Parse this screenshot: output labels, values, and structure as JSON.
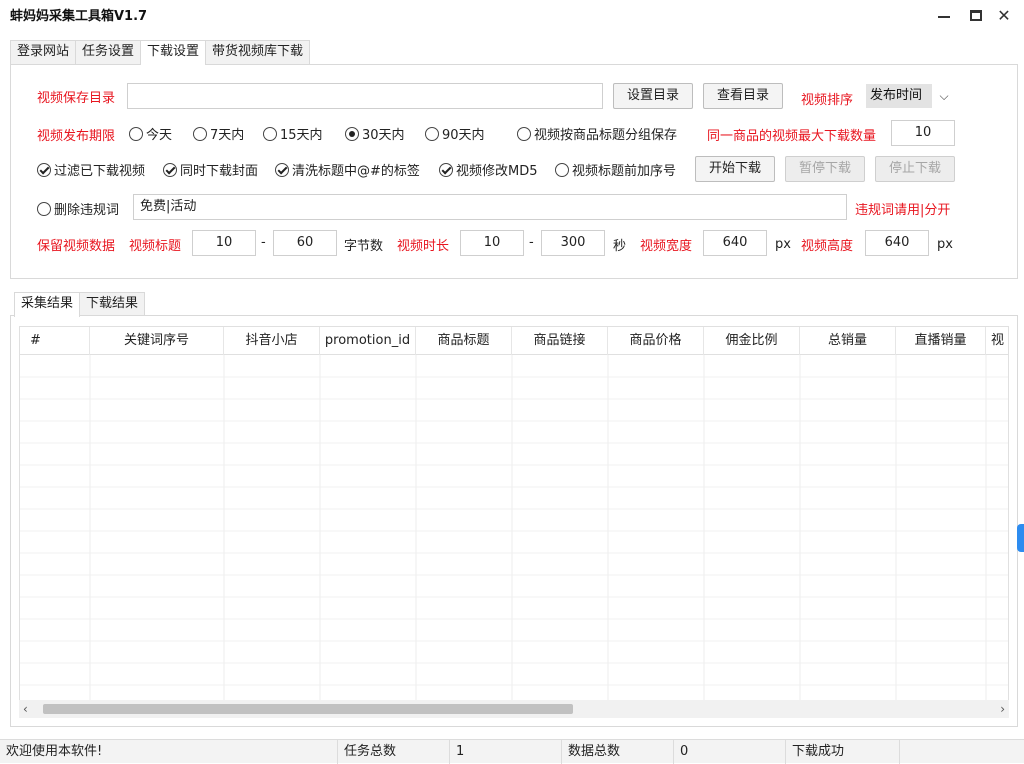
{
  "window": {
    "title": "蚌妈妈采集工具箱V1.7",
    "min_label": "—",
    "close_label": "✕"
  },
  "top_tabs": [
    "登录网站",
    "任务设置",
    "下载设置",
    "带货视频库下载"
  ],
  "download_settings": {
    "save_dir_label": "视频保存目录",
    "save_dir_value": "",
    "set_dir_button": "设置目录",
    "view_dir_button": "查看目录",
    "sort_label": "视频排序",
    "sort_value": "发布时间",
    "period_label": "视频发布期限",
    "period_options": [
      "今天",
      "7天内",
      "15天内",
      "30天内",
      "90天内"
    ],
    "period_selected": "30天内",
    "group_by_title": "视频按商品标题分组保存",
    "max_per_product_label": "同一商品的视频最大下载数量",
    "max_per_product_value": "10",
    "options": [
      "过滤已下载视频",
      "同时下载封面",
      "清洗标题中@#的标签",
      "视频修改MD5",
      "视频标题前加序号"
    ],
    "start_button": "开始下载",
    "pause_button": "暂停下载",
    "stop_button": "停止下载",
    "delete_words_label": "删除违规词",
    "delete_words_value": "免费|活动",
    "delete_words_hint": "违规词请用|分开",
    "keep_data_label": "保留视频数据",
    "title_label": "视频标题",
    "title_min": "10",
    "title_max": "60",
    "title_unit": "字节数",
    "duration_label": "视频时长",
    "duration_min": "10",
    "duration_max": "300",
    "duration_unit": "秒",
    "width_label": "视频宽度",
    "width_value": "640",
    "width_unit": "px",
    "height_label": "视频高度",
    "height_value": "640",
    "height_unit": "px",
    "dash": "-"
  },
  "result_tabs": [
    "采集结果",
    "下载结果"
  ],
  "table": {
    "columns": [
      "#",
      "关键词序号",
      "抖音小店",
      "promotion_id",
      "商品标题",
      "商品链接",
      "商品价格",
      "佣金比例",
      "总销量",
      "直播销量",
      "视"
    ]
  },
  "status": {
    "welcome": "欢迎使用本软件!",
    "task_total_label": "任务总数",
    "task_total_value": "1",
    "data_total_label": "数据总数",
    "data_total_value": "0",
    "download_status": "下载成功"
  }
}
